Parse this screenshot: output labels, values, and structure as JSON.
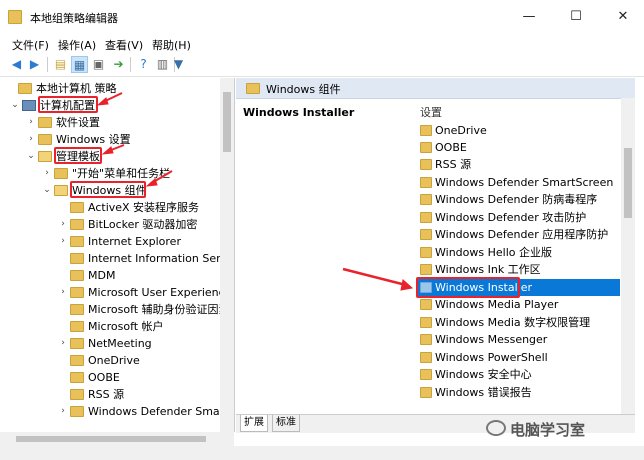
{
  "window": {
    "title": "本地组策略编辑器",
    "minimize_glyph": "—",
    "maximize_glyph": "☐",
    "close_glyph": "✕"
  },
  "menu": [
    "文件(F)",
    "操作(A)",
    "查看(V)",
    "帮助(H)"
  ],
  "toolbar": {
    "icons": [
      "back-arrow-icon",
      "forward-arrow-icon",
      "up-folder-icon",
      "show-tree-icon",
      "refresh-icon",
      "export-list-icon",
      "help-icon",
      "properties-icon",
      "filter-icon"
    ]
  },
  "tree": {
    "root": "本地计算机 策略",
    "items": [
      {
        "label": "计算机配置",
        "level": 1,
        "expanded": true,
        "icon": "computer-icon"
      },
      {
        "label": "软件设置",
        "level": 2,
        "expanded": false,
        "icon": "folder-icon"
      },
      {
        "label": "Windows 设置",
        "level": 2,
        "expanded": false,
        "icon": "folder-icon"
      },
      {
        "label": "管理模板",
        "level": 2,
        "expanded": true,
        "icon": "folder-icon"
      },
      {
        "label": "\"开始\"菜单和任务栏",
        "level": 3,
        "expanded": false,
        "icon": "folder-icon"
      },
      {
        "label": "Windows 组件",
        "level": 3,
        "expanded": true,
        "icon": "folder-icon"
      },
      {
        "label": "ActiveX 安装程序服务",
        "level": 4,
        "icon": "folder-icon"
      },
      {
        "label": "BitLocker 驱动器加密",
        "level": 4,
        "icon": "folder-icon"
      },
      {
        "label": "Internet Explorer",
        "level": 4,
        "icon": "folder-icon"
      },
      {
        "label": "Internet Information Servic",
        "level": 4,
        "icon": "folder-icon"
      },
      {
        "label": "MDM",
        "level": 4,
        "icon": "folder-icon"
      },
      {
        "label": "Microsoft User Experience",
        "level": 4,
        "icon": "folder-icon"
      },
      {
        "label": "Microsoft 辅助身份验证因素",
        "level": 4,
        "icon": "folder-icon"
      },
      {
        "label": "Microsoft 帐户",
        "level": 4,
        "icon": "folder-icon"
      },
      {
        "label": "NetMeeting",
        "level": 4,
        "icon": "folder-icon"
      },
      {
        "label": "OneDrive",
        "level": 4,
        "icon": "folder-icon"
      },
      {
        "label": "OOBE",
        "level": 4,
        "icon": "folder-icon"
      },
      {
        "label": "RSS 源",
        "level": 4,
        "icon": "folder-icon"
      },
      {
        "label": "Windows Defender SmartS",
        "level": 4,
        "icon": "folder-icon"
      }
    ]
  },
  "right": {
    "header": "Windows 组件",
    "selected_title": "Windows Installer",
    "column_header": "设置",
    "items": [
      "OneDrive",
      "OOBE",
      "RSS 源",
      "Windows Defender SmartScreen",
      "Windows Defender 防病毒程序",
      "Windows Defender 攻击防护",
      "Windows Defender 应用程序防护",
      "Windows Hello 企业版",
      "Windows Ink 工作区",
      "Windows Installer",
      "Windows Media Player",
      "Windows Media 数字权限管理",
      "Windows Messenger",
      "Windows PowerShell",
      "Windows 安全中心",
      "Windows 错误报告"
    ],
    "selected_index": 9
  },
  "tabs": [
    "扩展",
    "标准"
  ],
  "watermark": "电脑学习室",
  "colors": {
    "annotation_red": "#e8232c",
    "selection_blue": "#0a78d7",
    "folder_yellow": "#e8c15a"
  }
}
